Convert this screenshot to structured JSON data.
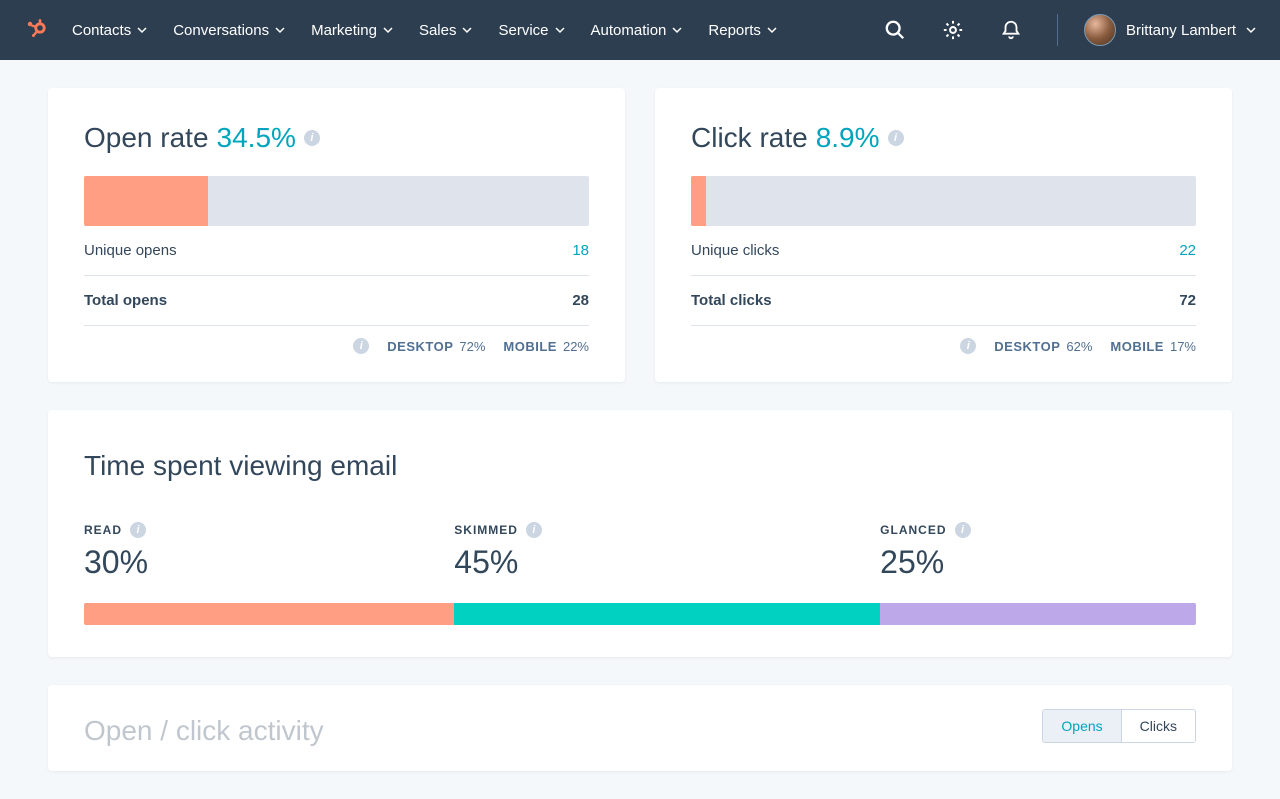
{
  "nav": {
    "items": [
      "Contacts",
      "Conversations",
      "Marketing",
      "Sales",
      "Service",
      "Automation",
      "Reports"
    ],
    "user_name": "Brittany Lambert"
  },
  "open_rate": {
    "label": "Open rate",
    "value": "34.5%",
    "bar_percent": 24.5,
    "unique_label": "Unique opens",
    "unique_value": "18",
    "total_label": "Total opens",
    "total_value": "28",
    "desktop_label": "DESKTOP",
    "desktop_value": "72%",
    "mobile_label": "MOBILE",
    "mobile_value": "22%"
  },
  "click_rate": {
    "label": "Click rate",
    "value": "8.9%",
    "bar_percent": 3,
    "unique_label": "Unique clicks",
    "unique_value": "22",
    "total_label": "Total clicks",
    "total_value": "72",
    "desktop_label": "DESKTOP",
    "desktop_value": "62%",
    "mobile_label": "MOBILE",
    "mobile_value": "17%"
  },
  "time_spent": {
    "title": "Time spent viewing email",
    "read": {
      "label": "READ",
      "value": "30%",
      "width": 33.3
    },
    "skimmed": {
      "label": "SKIMMED",
      "value": "45%",
      "width": 38.3
    },
    "glanced": {
      "label": "GLANCED",
      "value": "25%",
      "width": 28.4
    }
  },
  "bottom": {
    "title": "Open / click activity",
    "toggle_opens": "Opens",
    "toggle_clicks": "Clicks"
  },
  "chart_data": [
    {
      "type": "bar",
      "title": "Open rate",
      "value_percent": 34.5,
      "bar_fill_percent": 24.5,
      "rows": [
        {
          "label": "Unique opens",
          "value": 18
        },
        {
          "label": "Total opens",
          "value": 28
        }
      ],
      "breakdown": {
        "DESKTOP": 72,
        "MOBILE": 22
      }
    },
    {
      "type": "bar",
      "title": "Click rate",
      "value_percent": 8.9,
      "bar_fill_percent": 3,
      "rows": [
        {
          "label": "Unique clicks",
          "value": 22
        },
        {
          "label": "Total clicks",
          "value": 72
        }
      ],
      "breakdown": {
        "DESKTOP": 62,
        "MOBILE": 17
      }
    },
    {
      "type": "bar",
      "title": "Time spent viewing email",
      "categories": [
        "READ",
        "SKIMMED",
        "GLANCED"
      ],
      "values": [
        30,
        45,
        25
      ],
      "colors": [
        "#ff9e83",
        "#00d1c1",
        "#bda9ea"
      ]
    }
  ]
}
